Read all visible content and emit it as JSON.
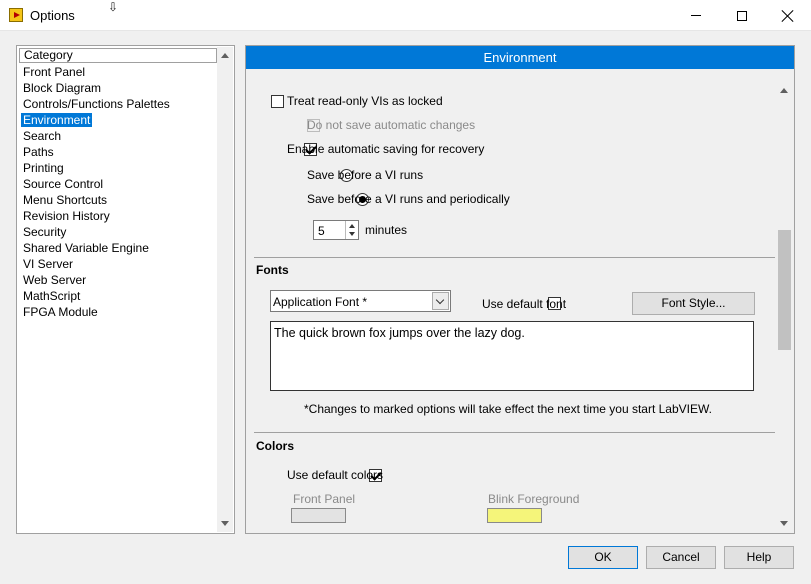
{
  "window": {
    "title": "Options"
  },
  "category": {
    "header": "Category",
    "items": [
      "Front Panel",
      "Block Diagram",
      "Controls/Functions Palettes",
      "Environment",
      "Search",
      "Paths",
      "Printing",
      "Source Control",
      "Menu Shortcuts",
      "Revision History",
      "Security",
      "Shared Variable Engine",
      "VI Server",
      "Web Server",
      "MathScript",
      "FPGA Module"
    ],
    "selected": "Environment"
  },
  "panel": {
    "title": "Environment",
    "treat_readonly": {
      "label": "Treat read-only VIs as locked",
      "checked": false
    },
    "no_auto_save": {
      "label": "Do not save automatic changes",
      "checked": false,
      "enabled": false
    },
    "auto_save": {
      "label": "Enable automatic saving for recovery",
      "checked": true
    },
    "radio_before": {
      "label": "Save before a VI runs",
      "selected": false
    },
    "radio_periodic": {
      "label": "Save before a VI runs and periodically",
      "selected": true
    },
    "minutes": {
      "value": "5",
      "label": "minutes"
    },
    "fonts": {
      "title": "Fonts",
      "selected_font": "Application Font *",
      "use_default_font": {
        "label": "Use default font",
        "checked": false
      },
      "font_style_button": "Font Style...",
      "sample": "The quick brown fox jumps over the lazy dog.",
      "note": "*Changes to marked options will take effect the next time you start LabVIEW."
    },
    "colors": {
      "title": "Colors",
      "use_default_colors": {
        "label": "Use default colors",
        "checked": true
      },
      "front_panel": {
        "label": "Front Panel",
        "color": "#e3e3e3"
      },
      "blink_foreground": {
        "label": "Blink Foreground",
        "color": "#f5f57a"
      }
    }
  },
  "buttons": {
    "ok": "OK",
    "cancel": "Cancel",
    "help": "Help"
  },
  "colors": {
    "accent": "#0078d7"
  }
}
